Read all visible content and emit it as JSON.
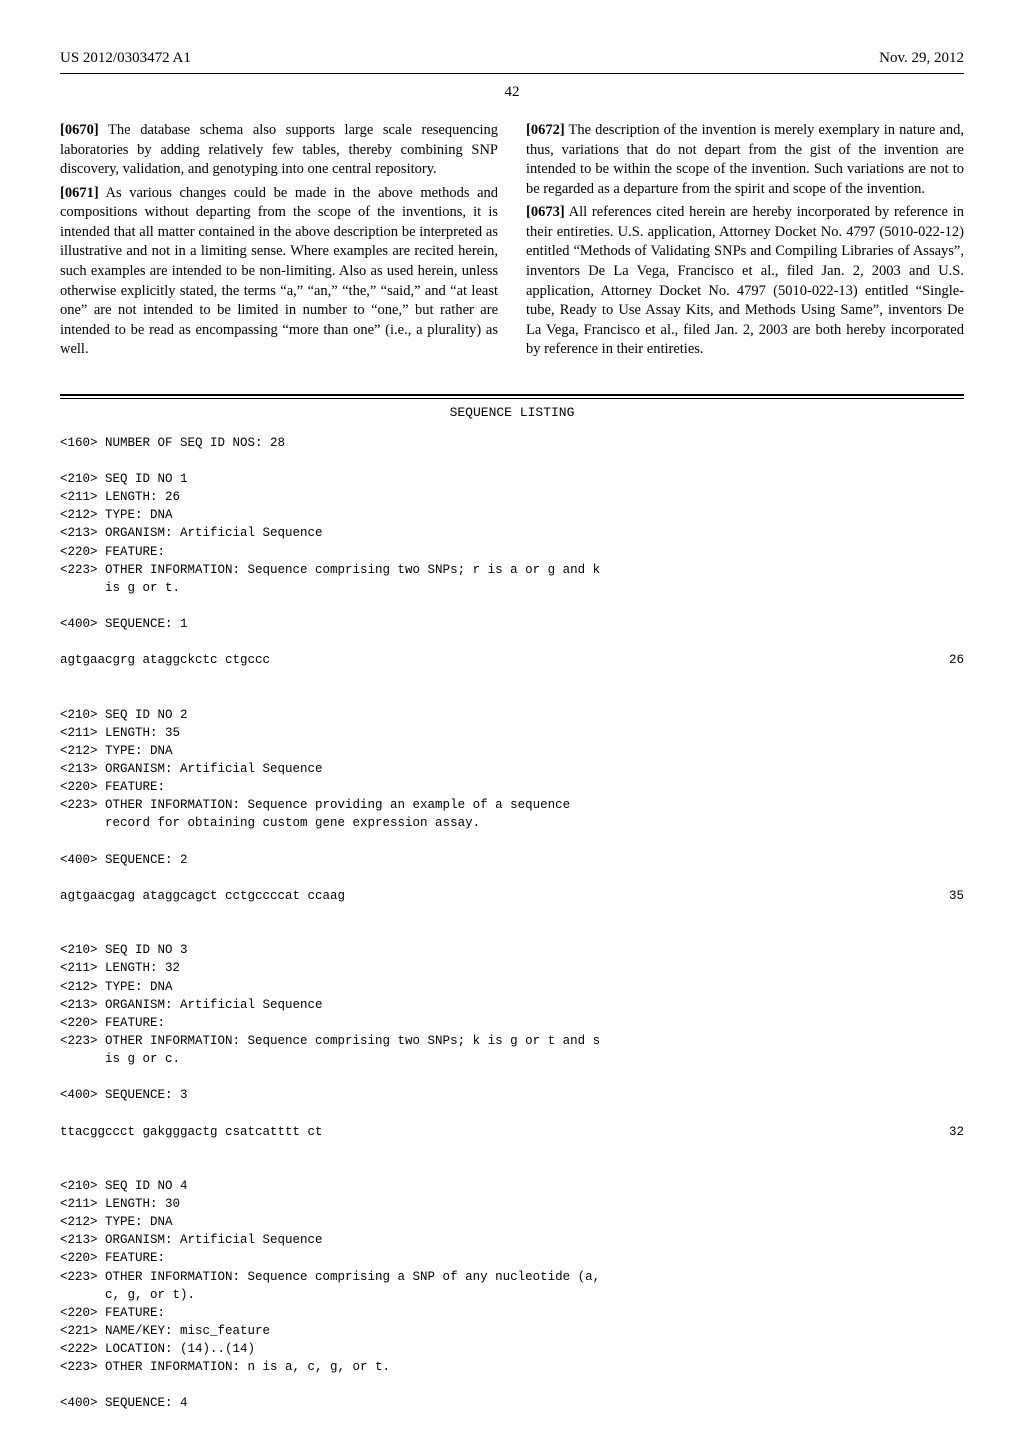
{
  "header": {
    "pubnum": "US 2012/0303472 A1",
    "date": "Nov. 29, 2012"
  },
  "page_number": "42",
  "left_col": {
    "p0670_num": "[0670]",
    "p0670": "  The database schema also supports large scale resequencing laboratories by adding relatively few tables, thereby combining SNP discovery, validation, and genotyping into one central repository.",
    "p0671_num": "[0671]",
    "p0671": "  As various changes could be made in the above methods and compositions without departing from the scope of the inventions, it is intended that all matter contained in the above description be interpreted as illustrative and not in a limiting sense. Where examples are recited herein, such examples are intended to be non-limiting. Also as used herein, unless otherwise explicitly stated, the terms “a,” “an,” “the,” “said,” and “at least one” are not intended to be limited in number to “one,” but rather are intended to be read as encompassing “more than one” (i.e., a plurality) as well."
  },
  "right_col": {
    "p0672_num": "[0672]",
    "p0672": "  The description of the invention is merely exemplary in nature and, thus, variations that do not depart from the gist of the invention are intended to be within the scope of the invention. Such variations are not to be regarded as a departure from the spirit and scope of the invention.",
    "p0673_num": "[0673]",
    "p0673": "  All references cited herein are hereby incorporated by reference in their entireties. U.S. application, Attorney Docket No. 4797 (5010-022-12) entitled “Methods of Validating SNPs and Compiling Libraries of Assays”, inventors De La Vega, Francisco et al., filed Jan. 2, 2003 and U.S. application, Attorney Docket No. 4797 (5010-022-13) entitled “Single-tube, Ready to Use Assay Kits, and Methods Using Same”, inventors De La Vega, Francisco et al., filed Jan. 2, 2003 are both hereby incorporated by reference in their entireties."
  },
  "seq_title": "SEQUENCE LISTING",
  "seq": {
    "count_line": "<160> NUMBER OF SEQ ID NOS: 28",
    "s1_h1": "<210> SEQ ID NO 1",
    "s1_h2": "<211> LENGTH: 26",
    "s1_h3": "<212> TYPE: DNA",
    "s1_h4": "<213> ORGANISM: Artificial Sequence",
    "s1_h5": "<220> FEATURE:",
    "s1_h6": "<223> OTHER INFORMATION: Sequence comprising two SNPs; r is a or g and k",
    "s1_h6b": "      is g or t.",
    "s1_400": "<400> SEQUENCE: 1",
    "s1_seq": "agtgaacgrg ataggckctc ctgccc",
    "s1_len": "26",
    "s2_h1": "<210> SEQ ID NO 2",
    "s2_h2": "<211> LENGTH: 35",
    "s2_h3": "<212> TYPE: DNA",
    "s2_h4": "<213> ORGANISM: Artificial Sequence",
    "s2_h5": "<220> FEATURE:",
    "s2_h6": "<223> OTHER INFORMATION: Sequence providing an example of a sequence",
    "s2_h6b": "      record for obtaining custom gene expression assay.",
    "s2_400": "<400> SEQUENCE: 2",
    "s2_seq": "agtgaacgag ataggcagct cctgccccat ccaag",
    "s2_len": "35",
    "s3_h1": "<210> SEQ ID NO 3",
    "s3_h2": "<211> LENGTH: 32",
    "s3_h3": "<212> TYPE: DNA",
    "s3_h4": "<213> ORGANISM: Artificial Sequence",
    "s3_h5": "<220> FEATURE:",
    "s3_h6": "<223> OTHER INFORMATION: Sequence comprising two SNPs; k is g or t and s",
    "s3_h6b": "      is g or c.",
    "s3_400": "<400> SEQUENCE: 3",
    "s3_seq": "ttacggccct gakgggactg csatcatttt ct",
    "s3_len": "32",
    "s4_h1": "<210> SEQ ID NO 4",
    "s4_h2": "<211> LENGTH: 30",
    "s4_h3": "<212> TYPE: DNA",
    "s4_h4": "<213> ORGANISM: Artificial Sequence",
    "s4_h5": "<220> FEATURE:",
    "s4_h6": "<223> OTHER INFORMATION: Sequence comprising a SNP of any nucleotide (a,",
    "s4_h6b": "      c, g, or t).",
    "s4_h7": "<220> FEATURE:",
    "s4_h8": "<221> NAME/KEY: misc_feature",
    "s4_h9": "<222> LOCATION: (14)..(14)",
    "s4_h10": "<223> OTHER INFORMATION: n is a, c, g, or t.",
    "s4_400": "<400> SEQUENCE: 4"
  }
}
